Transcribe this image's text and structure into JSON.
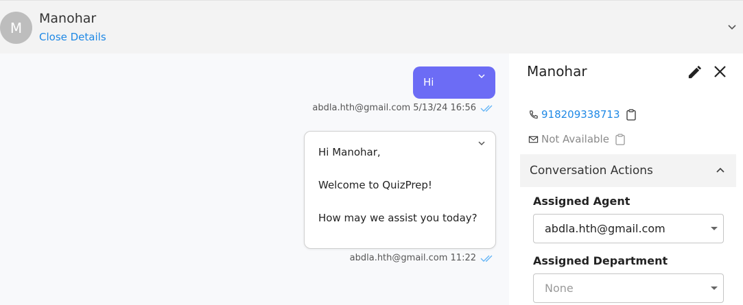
{
  "header": {
    "avatar_initial": "M",
    "contact_name": "Manohar",
    "close_details_label": "Close Details"
  },
  "chat": {
    "outgoing": {
      "text": "Hi",
      "meta": "abdla.hth@gmail.com 5/13/24 16:56"
    },
    "template": {
      "line1": "Hi Manohar,",
      "line2": "Welcome to QuizPrep!",
      "line3": "How may we assist you today?",
      "meta": "abdla.hth@gmail.com 11:22"
    }
  },
  "panel": {
    "name": "Manohar",
    "phone": "918209338713",
    "email": "Not Available",
    "actions_title": "Conversation Actions",
    "assigned_agent_label": "Assigned Agent",
    "assigned_agent_value": "abdla.hth@gmail.com",
    "assigned_department_label": "Assigned Department",
    "assigned_department_value": "None"
  },
  "colors": {
    "accent": "#6c6cf5",
    "link": "#1e88e5",
    "read_ticks": "#64b5f6"
  },
  "icons": [
    "chevron-down-icon",
    "pencil-icon",
    "close-icon",
    "phone-icon",
    "mail-icon",
    "clipboard-icon",
    "chevron-up-icon",
    "double-check-icon",
    "caret-down-icon"
  ]
}
